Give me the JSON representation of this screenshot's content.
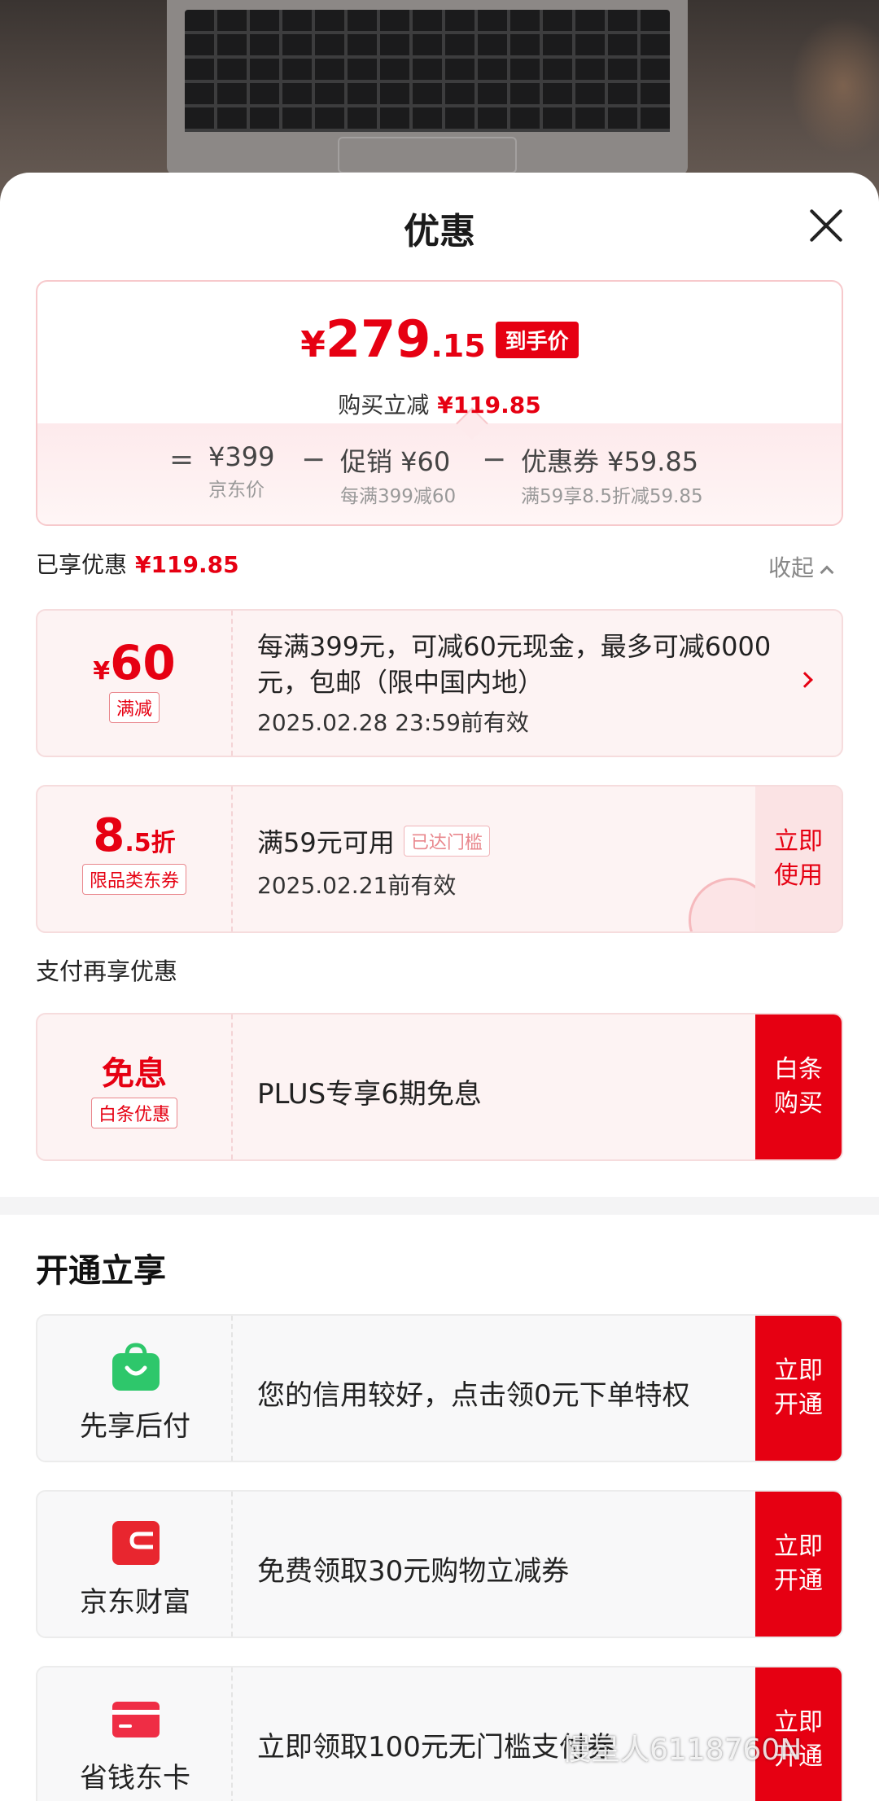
{
  "sheet": {
    "title": "优惠"
  },
  "price": {
    "yen": "¥",
    "integer": "279",
    "decimal": ".15",
    "tag": "到手价",
    "reduce_label": "购买立减",
    "reduce_value": "¥119.85",
    "eq": "=",
    "items": [
      {
        "value": "¥399",
        "sub": "京东价"
      },
      {
        "value": "促销 ¥60",
        "sub": "每满399减60"
      },
      {
        "value": "优惠券 ¥59.85",
        "sub": "满59享8.5折减59.85"
      }
    ],
    "minus": "−"
  },
  "enjoyed": {
    "label": "已享优惠",
    "value": "¥119.85",
    "collapse": "收起"
  },
  "promo1": {
    "yen": "¥",
    "amount": "60",
    "badge": "满减",
    "desc": "每满399元，可减60元现金，最多可减6000元，包邮（限中国内地）",
    "valid": "2025.02.28 23:59前有效"
  },
  "promo2": {
    "amount": "8",
    "amount_small": ".5折",
    "badge": "限品类东券",
    "desc": "满59元可用",
    "tag": "已达门槛",
    "valid": "2025.02.21前有效",
    "button": "立即使用"
  },
  "pay_section": {
    "title": "支付再享优惠"
  },
  "pay1": {
    "title": "免息",
    "badge": "白条优惠",
    "desc": "PLUS专享6期免息",
    "button": "白条购买"
  },
  "open_section": {
    "title": "开通立享"
  },
  "open_items": [
    {
      "label": "先享后付",
      "desc": "您的信用较好，点击领0元下单特权",
      "button": "立即开通",
      "icon": "green-bag-icon",
      "color": "#2ec76b"
    },
    {
      "label": "京东财富",
      "desc": "免费领取30元购物立减券",
      "button": "立即开通",
      "icon": "red-wallet-icon",
      "color": "#e8262f"
    },
    {
      "label": "省钱东卡",
      "desc": "立即领取100元无门槛支付券",
      "button": "立即开通",
      "icon": "red-card-icon",
      "color": "#ef2d45"
    }
  ],
  "watermark": "慢星人6118760N",
  "colors": {
    "accent": "#e60012"
  }
}
